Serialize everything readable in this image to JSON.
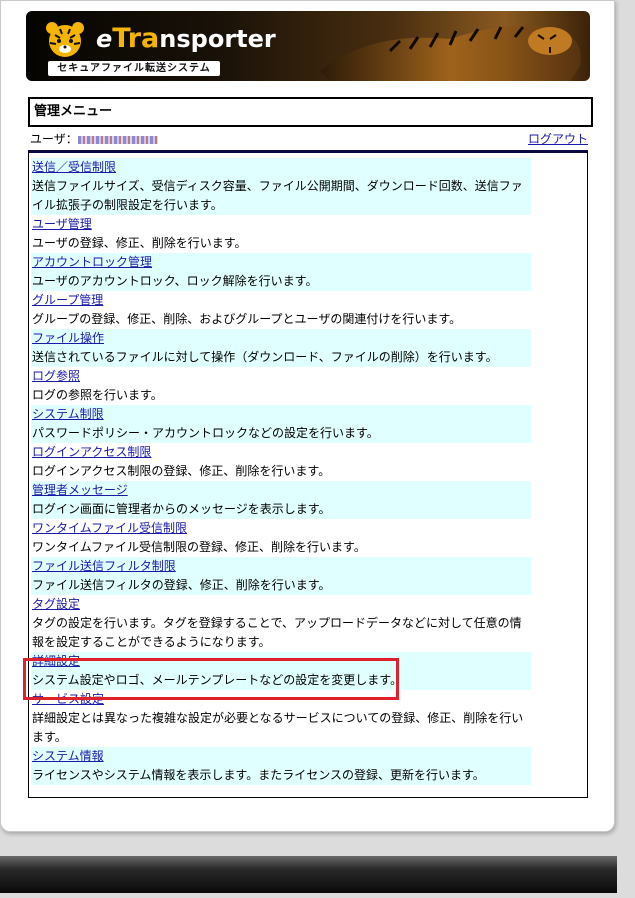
{
  "header": {
    "logo_text_e": "e",
    "logo_text_tra": "Tra",
    "logo_text_rest": "nsporter",
    "logo_subtitle": "セキュアファイル転送システム",
    "brand_colors": {
      "accent": "#f4b400",
      "dark": "#1a1208"
    }
  },
  "page": {
    "title": "管理メニュー",
    "user_label": "ユーザ：",
    "logout_label": "ログアウト"
  },
  "menu": {
    "items": [
      {
        "label": "送信／受信制限",
        "desc": "送信ファイルサイズ、受信ディスク容量、ファイル公開期間、ダウンロード回数、送信ファイル拡張子の制限設定を行います。"
      },
      {
        "label": "ユーザ管理",
        "desc": "ユーザの登録、修正、削除を行います。"
      },
      {
        "label": "アカウントロック管理",
        "desc": "ユーザのアカウントロック、ロック解除を行います。"
      },
      {
        "label": "グループ管理",
        "desc": "グループの登録、修正、削除、およびグループとユーザの関連付けを行います。"
      },
      {
        "label": "ファイル操作",
        "desc": "送信されているファイルに対して操作（ダウンロード、ファイルの削除）を行います。"
      },
      {
        "label": "ログ参照",
        "desc": "ログの参照を行います。"
      },
      {
        "label": "システム制限",
        "desc": "パスワードポリシー・アカウントロックなどの設定を行います。"
      },
      {
        "label": "ログインアクセス制限",
        "desc": "ログインアクセス制限の登録、修正、削除を行います。"
      },
      {
        "label": "管理者メッセージ",
        "desc": "ログイン画面に管理者からのメッセージを表示します。"
      },
      {
        "label": "ワンタイムファイル受信制限",
        "desc": "ワンタイムファイル受信制限の登録、修正、削除を行います。"
      },
      {
        "label": "ファイル送信フィルタ制限",
        "desc": "ファイル送信フィルタの登録、修正、削除を行います。"
      },
      {
        "label": "タグ設定",
        "desc": "タグの設定を行います。タグを登録することで、アップロードデータなどに対して任意の情報を設定することができるようになります。"
      },
      {
        "label": "詳細設定",
        "desc": "システム設定やロゴ、メールテンプレートなどの設定を変更します。"
      },
      {
        "label": "サービス設定",
        "desc": "詳細設定とは異なった複雑な設定が必要となるサービスについての登録、修正、削除を行います。"
      },
      {
        "label": "システム情報",
        "desc": "ライセンスやシステム情報を表示します。またライセンスの登録、更新を行います。"
      }
    ]
  },
  "colors": {
    "row_shade": "#e0ffff",
    "link": "#1a1aa8",
    "highlight": "#e0202a"
  }
}
